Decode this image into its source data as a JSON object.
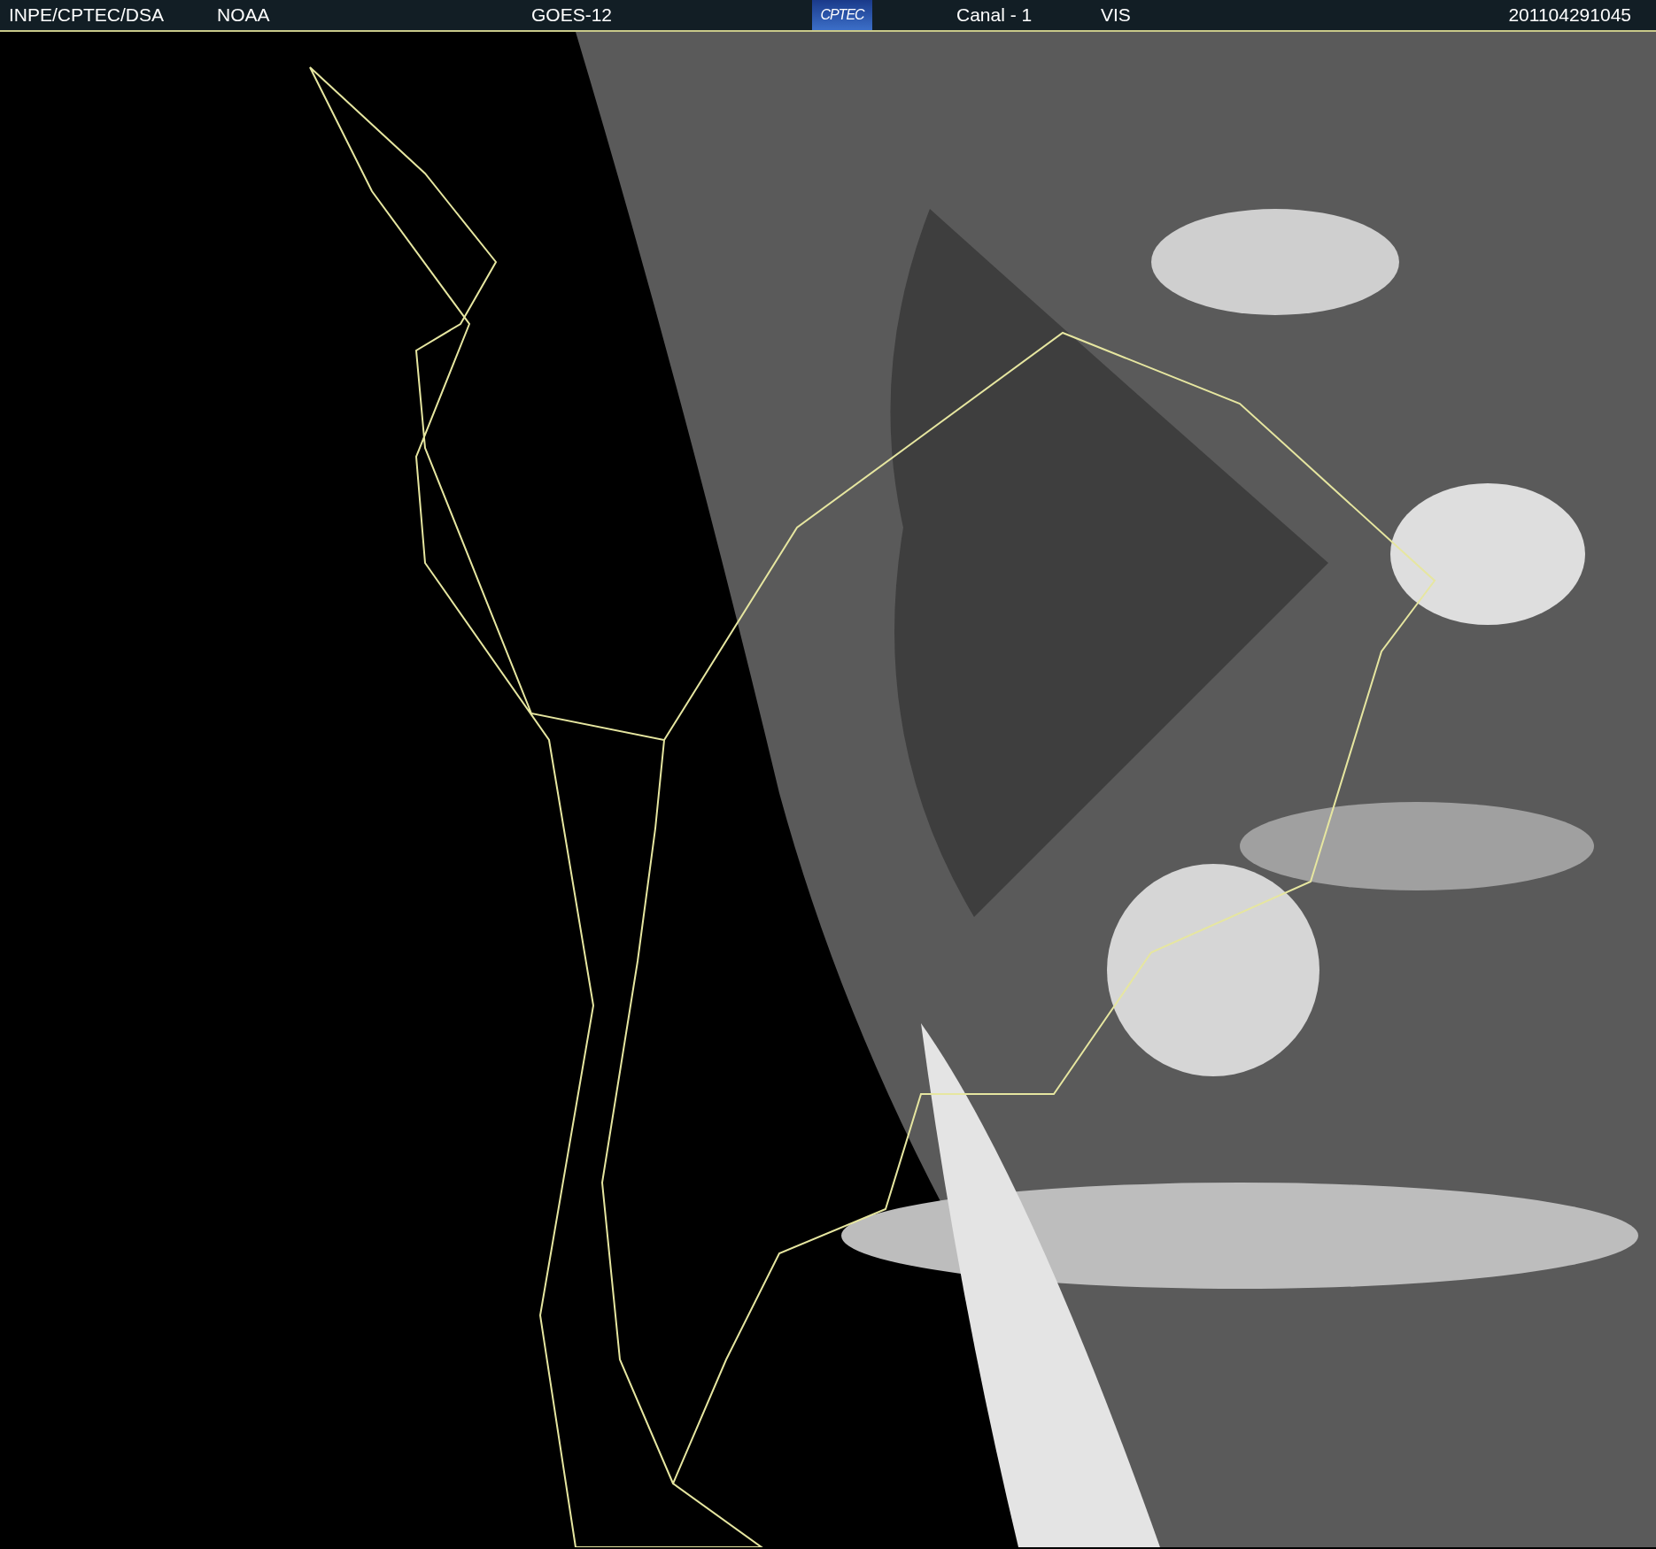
{
  "header": {
    "source": "INPE/CPTEC/DSA",
    "agency": "NOAA",
    "satellite": "GOES-12",
    "logo": "CPTEC",
    "channel": "Canal - 1",
    "band": "VIS",
    "timestamp": "201104291045"
  }
}
